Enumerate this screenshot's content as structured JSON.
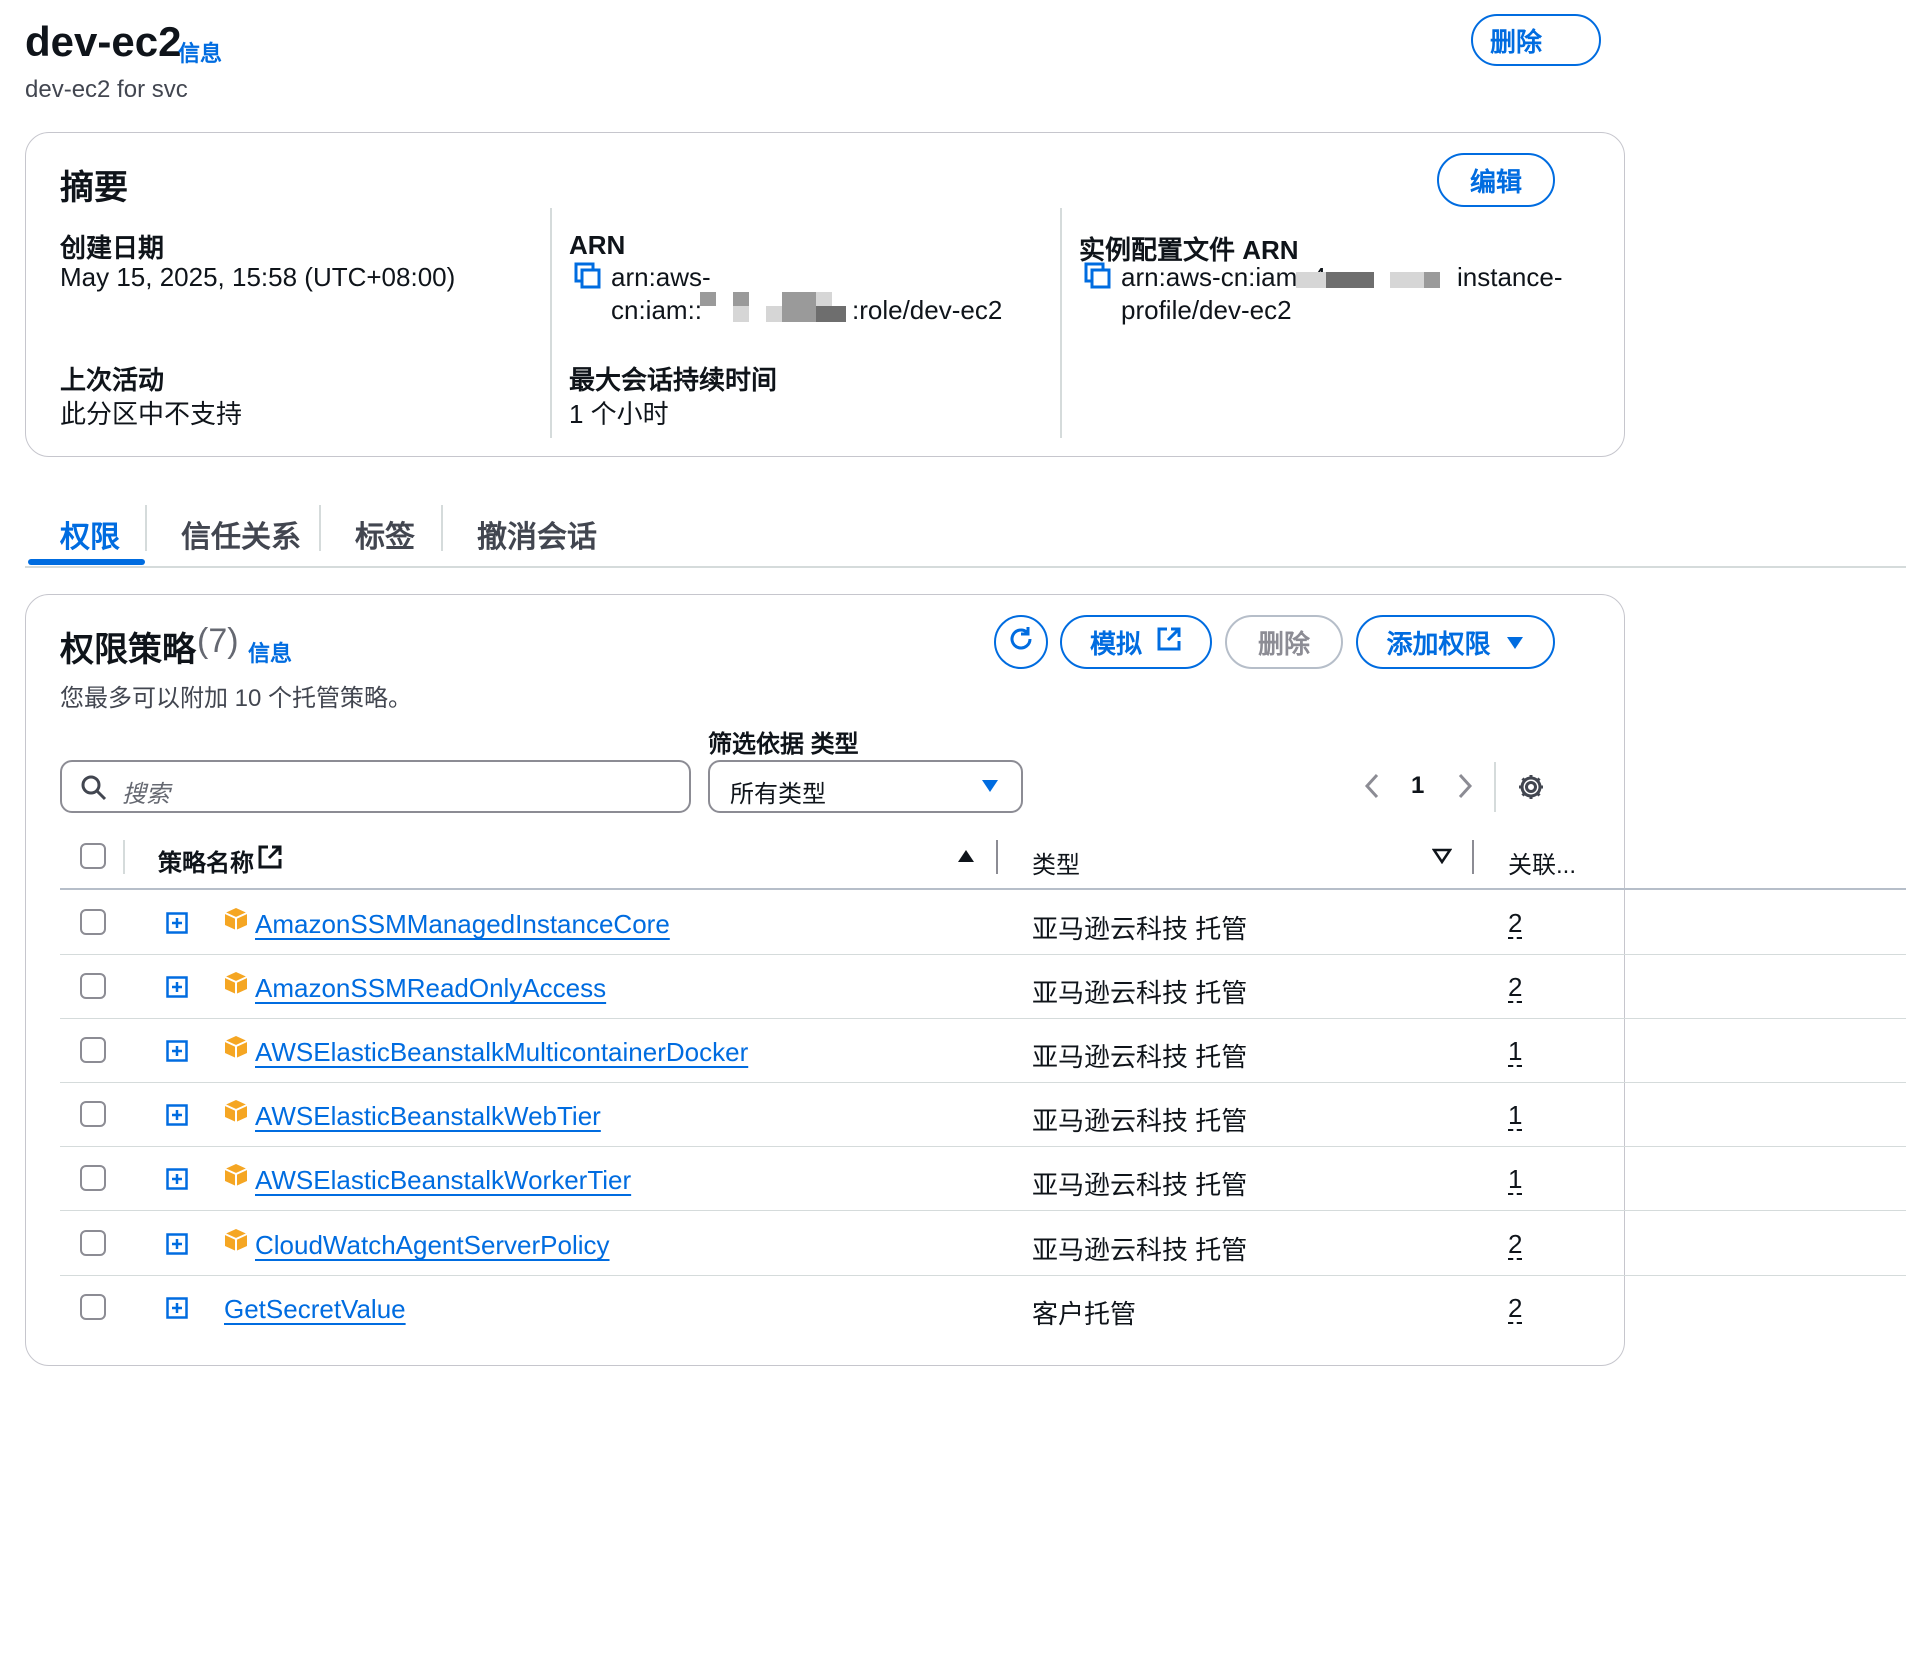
{
  "header": {
    "title": "dev-ec2",
    "info_label": "信息",
    "description": "dev-ec2 for svc",
    "delete_label": "删除"
  },
  "summary": {
    "title": "摘要",
    "edit_label": "编辑",
    "created_label": "创建日期",
    "created_value": "May 15, 2025, 15:58 (UTC+08:00)",
    "last_activity_label": "上次活动",
    "last_activity_value": "此分区中不支持",
    "arn_label": "ARN",
    "arn_line1": "arn:aws-",
    "arn_line2_prefix": "cn:iam::",
    "arn_line2_suffix": ":role/dev-ec2",
    "max_session_label": "最大会话持续时间",
    "max_session_value": "1 个小时",
    "instance_profile_label": "实例配置文件 ARN",
    "instance_profile_line1_prefix": "arn:aws-cn:iam::4",
    "instance_profile_line1_suffix": "instance-",
    "instance_profile_line2": "profile/dev-ec2"
  },
  "tabs": [
    {
      "label": "权限",
      "active": true
    },
    {
      "label": "信任关系",
      "active": false
    },
    {
      "label": "标签",
      "active": false
    },
    {
      "label": "撤消会话",
      "active": false
    }
  ],
  "permissions": {
    "title": "权限策略",
    "count": "(7)",
    "info_label": "信息",
    "subtitle": "您最多可以附加 10 个托管策略。",
    "simulate_label": "模拟",
    "delete_label": "删除",
    "add_label": "添加权限",
    "filter_label": "筛选依据 类型",
    "search_placeholder": "搜索",
    "type_select_value": "所有类型",
    "page_number": "1",
    "columns": {
      "name": "策略名称",
      "type": "类型",
      "attached": "关联..."
    },
    "rows": [
      {
        "name": "AmazonSSMManagedInstanceCore",
        "type": "亚马逊云科技 托管",
        "attached": "2",
        "aws_managed": true
      },
      {
        "name": "AmazonSSMReadOnlyAccess",
        "type": "亚马逊云科技 托管",
        "attached": "2",
        "aws_managed": true
      },
      {
        "name": "AWSElasticBeanstalkMulticontainerDocker",
        "type": "亚马逊云科技 托管",
        "attached": "1",
        "aws_managed": true
      },
      {
        "name": "AWSElasticBeanstalkWebTier",
        "type": "亚马逊云科技 托管",
        "attached": "1",
        "aws_managed": true
      },
      {
        "name": "AWSElasticBeanstalkWorkerTier",
        "type": "亚马逊云科技 托管",
        "attached": "1",
        "aws_managed": true
      },
      {
        "name": "CloudWatchAgentServerPolicy",
        "type": "亚马逊云科技 托管",
        "attached": "2",
        "aws_managed": true
      },
      {
        "name": "GetSecretValue",
        "type": "客户托管",
        "attached": "2",
        "aws_managed": false
      }
    ]
  },
  "colors": {
    "accent": "#006ce0",
    "text": "#0f141a",
    "border": "#c6c6cd",
    "disabled": "#b6bec9",
    "package": "#f5a623"
  },
  "icons": [
    "copy-icon",
    "refresh-icon",
    "external-link-icon",
    "caret-down-icon",
    "search-icon",
    "chevron-left-icon",
    "chevron-right-icon",
    "gear-icon",
    "sort-ascending-icon",
    "sort-descending-icon",
    "expand-icon",
    "package-icon"
  ]
}
